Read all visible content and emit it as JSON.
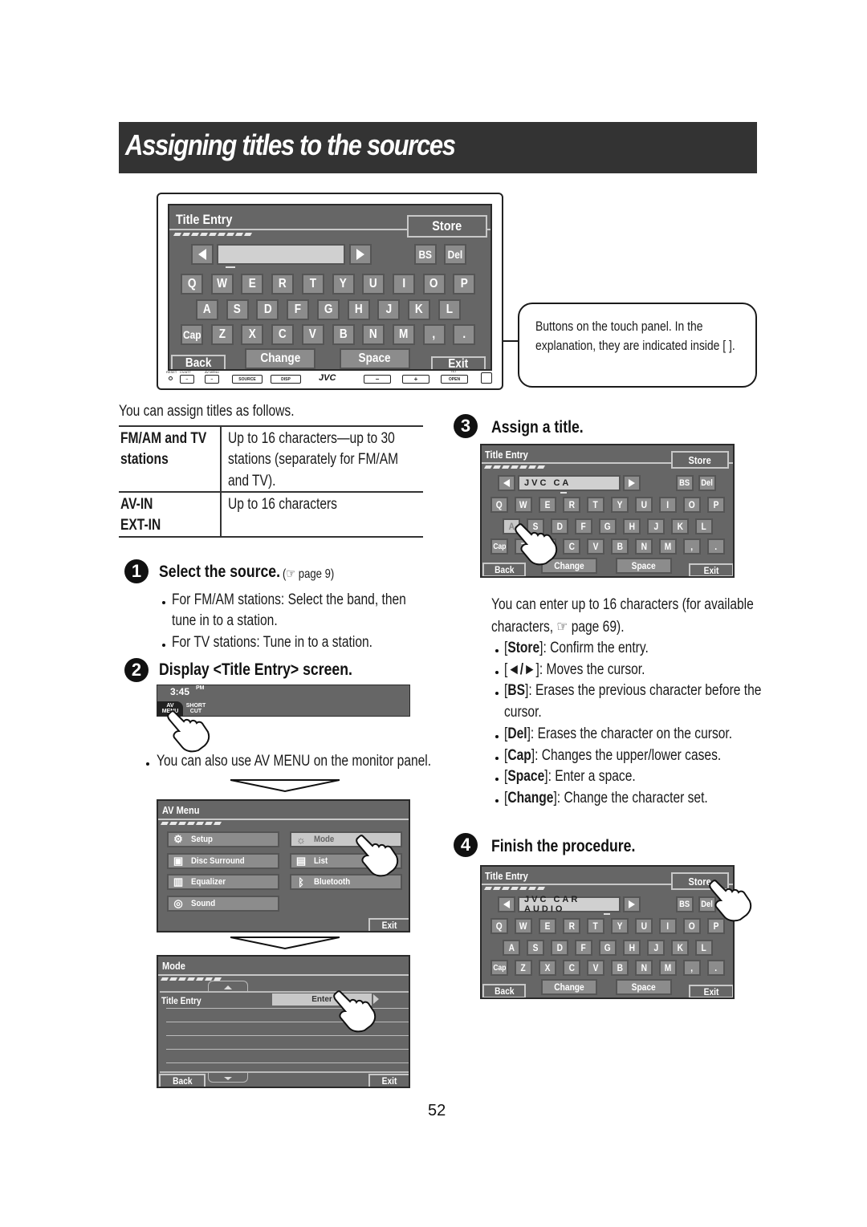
{
  "page_title": "Assigning titles to the sources",
  "page_number": "52",
  "device_screen": {
    "title": "Title Entry",
    "store_label": "Store",
    "bs_label": "BS",
    "del_label": "Del",
    "field_value": "",
    "row1": [
      "Q",
      "W",
      "E",
      "R",
      "T",
      "Y",
      "U",
      "I",
      "O",
      "P"
    ],
    "row2": [
      "A",
      "S",
      "D",
      "F",
      "G",
      "H",
      "J",
      "K",
      "L"
    ],
    "row3": [
      "Cap",
      "Z",
      "X",
      "C",
      "V",
      "B",
      "N",
      "M",
      ",",
      "."
    ],
    "back_label": "Back",
    "change_label": "Change",
    "space_label": "Space",
    "exit_label": "Exit",
    "hw": {
      "reset": "RESET",
      "att": "CV/ATT",
      "avmenu": "AV MENU",
      "source": "SOURCE",
      "disp": "DISP",
      "brand": "JVC",
      "minus": "−",
      "plus": "+",
      "tilt": "TILT",
      "open": "OPEN"
    }
  },
  "callout": {
    "text": "Buttons on the touch panel. In the explanation, they are indicated inside [      ]."
  },
  "intro": "You can assign titles as follows.",
  "table": {
    "rows": [
      {
        "source_line1": "FM/AM and TV",
        "source_line2": "stations",
        "desc_lines": [
          "Up to 16 characters—up to 30",
          "stations (separately for FM/AM",
          "and TV)."
        ]
      },
      {
        "source_line1": "AV-IN",
        "source_line2": "EXT-IN",
        "desc_lines": [
          "Up to 16 characters"
        ]
      }
    ]
  },
  "step1": {
    "num": "1",
    "title": "Select the source.",
    "ref": "(☞ page 9)",
    "bullets": [
      "For FM/AM stations: Select the band, then",
      "tune in to a station.",
      "For TV stations: Tune in to a station."
    ]
  },
  "step2": {
    "num": "2",
    "title": "Display <Title Entry> screen.",
    "clock": "3:45",
    "clock_suffix": "PM",
    "av_menu_btn": [
      "AV",
      "MENU"
    ],
    "shortcut_btn": [
      "SHORT",
      "CUT"
    ],
    "note": "You can also use AV MENU on the monitor panel."
  },
  "av_menu_screen": {
    "title": "AV Menu",
    "left_items": [
      {
        "label": "Setup",
        "icon": "gears-icon"
      },
      {
        "label": "Disc Surround",
        "icon": "surround-icon"
      },
      {
        "label": "Equalizer",
        "icon": "equalizer-icon"
      },
      {
        "label": "Sound",
        "icon": "sound-icon"
      }
    ],
    "right_items": [
      {
        "label": "Mode",
        "icon": "mode-icon"
      },
      {
        "label": "List",
        "icon": "list-icon"
      },
      {
        "label": "Bluetooth",
        "icon": "bluetooth-icon"
      }
    ],
    "exit_label": "Exit"
  },
  "mode_screen": {
    "title": "Mode",
    "item_label": "Title Entry",
    "enter_label": "Enter",
    "back_label": "Back",
    "exit_label": "Exit"
  },
  "step3": {
    "num": "3",
    "title": "Assign a title.",
    "screen": {
      "title": "Title Entry",
      "store_label": "Store",
      "field_value": "JVC CA",
      "bs_label": "BS",
      "del_label": "Del",
      "back_label": "Back",
      "change_label": "Change",
      "space_label": "Space",
      "exit_label": "Exit"
    },
    "desc_line1": "You can enter up to 16 characters (for available",
    "desc_line2": "characters, ☞ page 69).",
    "bullets": [
      {
        "key": "Store",
        "text": ": Confirm the entry."
      },
      {
        "key": "◄/►",
        "text": ": Moves the cursor."
      },
      {
        "key": "BS",
        "text": ": Erases the previous character before the",
        "cont": "cursor."
      },
      {
        "key": "Del",
        "text": ": Erases the character on the cursor."
      },
      {
        "key": "Cap",
        "text": ": Changes the upper/lower cases."
      },
      {
        "key": "Space",
        "text": ": Enter a space."
      },
      {
        "key": "Change",
        "text": ": Change the character set."
      }
    ]
  },
  "step4": {
    "num": "4",
    "title": "Finish the procedure.",
    "screen": {
      "title": "Title Entry",
      "store_label": "Store",
      "field_value": "JVC CAR AUDIO",
      "bs_label": "BS",
      "del_label": "Del",
      "back_label": "Back",
      "change_label": "Change",
      "space_label": "Space",
      "exit_label": "Exit"
    }
  }
}
